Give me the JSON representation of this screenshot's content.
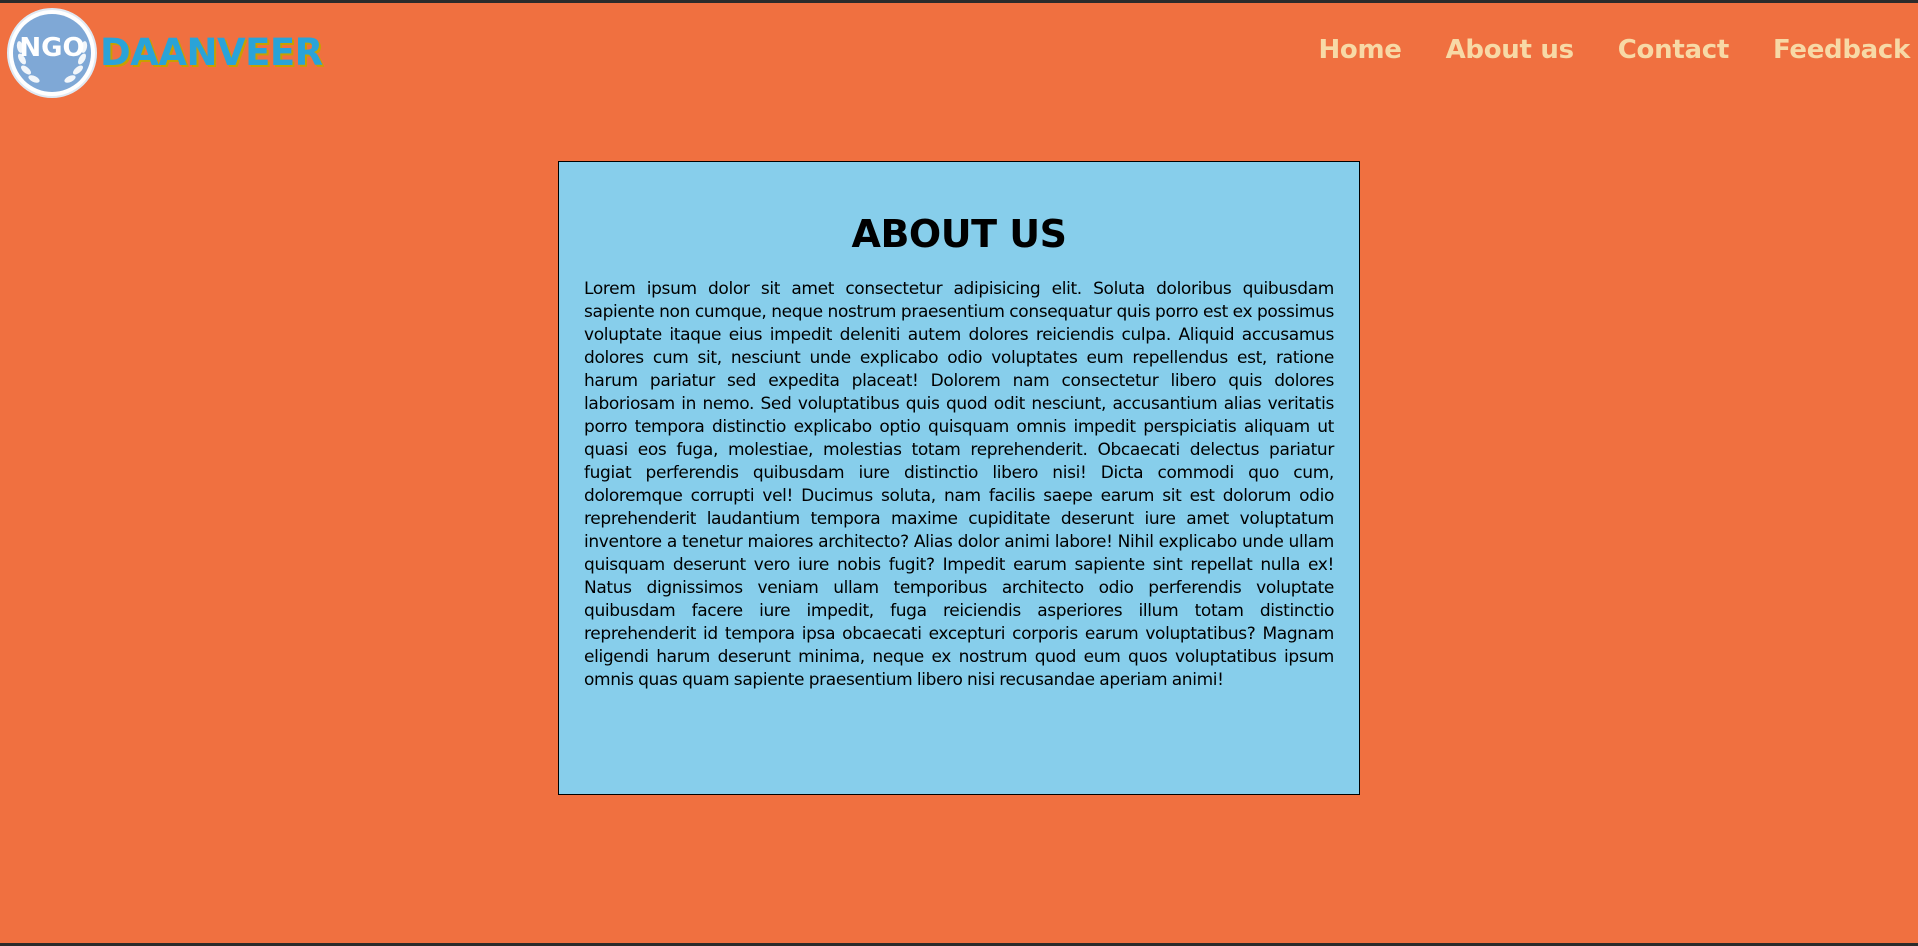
{
  "header": {
    "logo_text": "NGO",
    "brand": "DAANVEER",
    "nav": [
      "Home",
      "About us",
      "Contact",
      "Feedback"
    ]
  },
  "about": {
    "title": "ABOUT US",
    "body": "Lorem ipsum dolor sit amet consectetur adipisicing elit. Soluta doloribus quibusdam sapiente non cumque, neque nostrum praesentium consequatur quis porro est ex possimus voluptate itaque eius impedit deleniti autem dolores reiciendis culpa. Aliquid accusamus dolores cum sit, nesciunt unde explicabo odio voluptates eum repellendus est, ratione harum pariatur sed expedita placeat! Dolorem nam consectetur libero quis dolores laboriosam in nemo. Sed voluptatibus quis quod odit nesciunt, accusantium alias veritatis porro tempora distinctio explicabo optio quisquam omnis impedit perspiciatis aliquam ut quasi eos fuga, molestiae, molestias totam reprehenderit. Obcaecati delectus pariatur fugiat perferendis quibusdam iure distinctio libero nisi! Dicta commodi quo cum, doloremque corrupti vel! Ducimus soluta, nam facilis saepe earum sit est dolorum odio reprehenderit laudantium tempora maxime cupiditate deserunt iure amet voluptatum inventore a tenetur maiores architecto? Alias dolor animi labore! Nihil explicabo unde ullam quisquam deserunt vero iure nobis fugit? Impedit earum sapiente sint repellat nulla ex! Natus dignissimos veniam ullam temporibus architecto odio perferendis voluptate quibusdam facere iure impedit, fuga reiciendis asperiores illum totam distinctio reprehenderit id tempora ipsa obcaecati excepturi corporis earum voluptatibus? Magnam eligendi harum deserunt minima, neque ex nostrum quod eum quos voluptatibus ipsum omnis quas quam sapiente praesentium libero nisi recusandae aperiam animi!"
  },
  "colors": {
    "page_background": "#f07040",
    "card_background": "#87ceeb",
    "nav_text": "#f7d9a6",
    "brand_text": "#2aa3d8",
    "brand_shadow": "#c8a000",
    "logo_fill": "#7fa8d6"
  }
}
